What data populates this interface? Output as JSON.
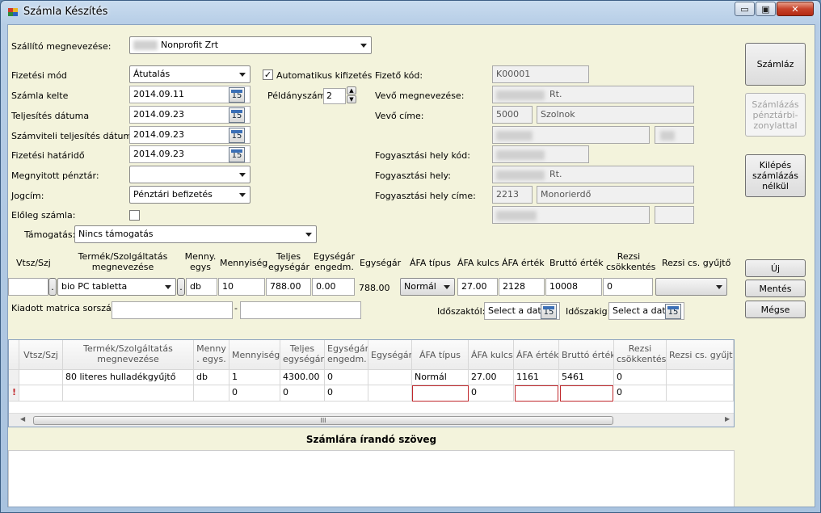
{
  "window": {
    "title": "Számla Készítés",
    "minimize": "▭",
    "maximize": "▣",
    "close": "✕"
  },
  "form": {
    "supplier_label": "Szállító megnevezése:",
    "supplier_value": "Nonprofit Zrt",
    "payment_label": "Fizetési mód",
    "payment_value": "Átutalás",
    "auto_pay_label": "Automatikus kifizetés",
    "copies_label": "Példányszám",
    "copies_value": "2",
    "invoice_date_label": "Számla kelte",
    "invoice_date_value": "2014.09.11",
    "fulfil_date_label": "Teljesítés dátuma",
    "fulfil_date_value": "2014.09.23",
    "acc_fulfil_label": "Számviteli teljesítés dátum",
    "acc_fulfil_value": "2014.09.23",
    "due_date_label": "Fizetési határidő",
    "due_date_value": "2014.09.23",
    "cashdesk_label": "Megnyitott pénztár:",
    "cashdesk_value": "",
    "title_label": "Jogcím:",
    "title_value": "Pénztári befizetés",
    "advance_label": "Előleg számla:",
    "subsidy_label": "Támogatás:",
    "subsidy_value": "Nincs támogatás",
    "payer_code_label": "Fizető kód:",
    "payer_code_value": "K00001",
    "buyer_name_label": "Vevő megnevezése:",
    "buyer_name_value": "Rt.",
    "buyer_addr_label": "Vevő címe:",
    "buyer_zip": "5000",
    "buyer_city": "Szolnok",
    "cons_code_label": "Fogyasztási hely kód:",
    "cons_place_label": "Fogyasztási hely:",
    "cons_place_value": "Rt.",
    "cons_addr_label": "Fogyasztási hely címe:",
    "cons_zip": "2213",
    "cons_city": "Monorierdő"
  },
  "item_headers": {
    "vtsz": "Vtsz/Szj",
    "product": "Termék/Szolgáltatás megnevezése",
    "unit": "Menny. egys",
    "qty": "Mennyiség",
    "full_price": "Teljes egységár",
    "discount": "Egységár engedm.",
    "unit_price": "Egységár",
    "vat_type": "ÁFA típus",
    "vat_rate": "ÁFA kulcs",
    "vat_value": "ÁFA érték",
    "gross": "Bruttó érték",
    "utility": "Rezsi csökkentés",
    "utility_coll": "Rezsi cs. gyűjtő"
  },
  "item_row": {
    "vtsz": "",
    "dot": ".",
    "product": "bio PC tabletta",
    "unit": "db",
    "qty": "10",
    "full_price": "788.00",
    "discount": "0.00",
    "unit_price": "788.00",
    "vat_type": "Normál",
    "vat_rate": "27.00",
    "vat_value": "2128",
    "gross": "10008",
    "utility": "0",
    "utility_coll": ""
  },
  "sticker_label": "Kiadott matrica sorszám:",
  "sticker_dash": "-",
  "period_from_label": "Időszaktól:",
  "period_from_value": "Select a date",
  "period_to_label": "Időszakig:",
  "period_to_value": "Select a date",
  "grid": {
    "headers": {
      "vtsz": "Vtsz/Szj",
      "product": "Termék/Szolgáltatás megnevezése",
      "unit": "Menny . egys.",
      "qty": "Mennyiség",
      "full_price": "Teljes egységár",
      "discount": "Egységár engedm.",
      "unit_price": "Egységár",
      "vat_type": "ÁFA típus",
      "vat_rate": "ÁFA kulcs",
      "vat_value": "ÁFA érték",
      "gross": "Bruttó érték",
      "utility": "Rezsi csökkentés",
      "utility_coll": "Rezsi cs. gyűjtő"
    },
    "row1": {
      "product": "80 literes hulladékgyűjtő",
      "unit": "db",
      "qty": "1",
      "full_price": "4300.00",
      "discount": "0",
      "vat_type": "Normál",
      "vat_rate": "27.00",
      "vat_value": "1161",
      "gross": "5461",
      "utility": "0"
    },
    "row2": {
      "marker": "!",
      "qty": "0",
      "full_price": "0",
      "discount": "0",
      "vat_rate": "0",
      "utility": "0"
    },
    "scroll_grip": "III"
  },
  "notes_title": "Számlára írandó szöveg",
  "buttons": {
    "invoice": "Számláz",
    "invoice_cash": "Számlázás pénztárbi-zonylattal",
    "exit": "Kilépés számlázás nélkül",
    "new": "Új",
    "save": "Mentés",
    "cancel": "Mégse"
  },
  "colors": {
    "accent": "#3b6fb6",
    "error": "#c0282c"
  }
}
